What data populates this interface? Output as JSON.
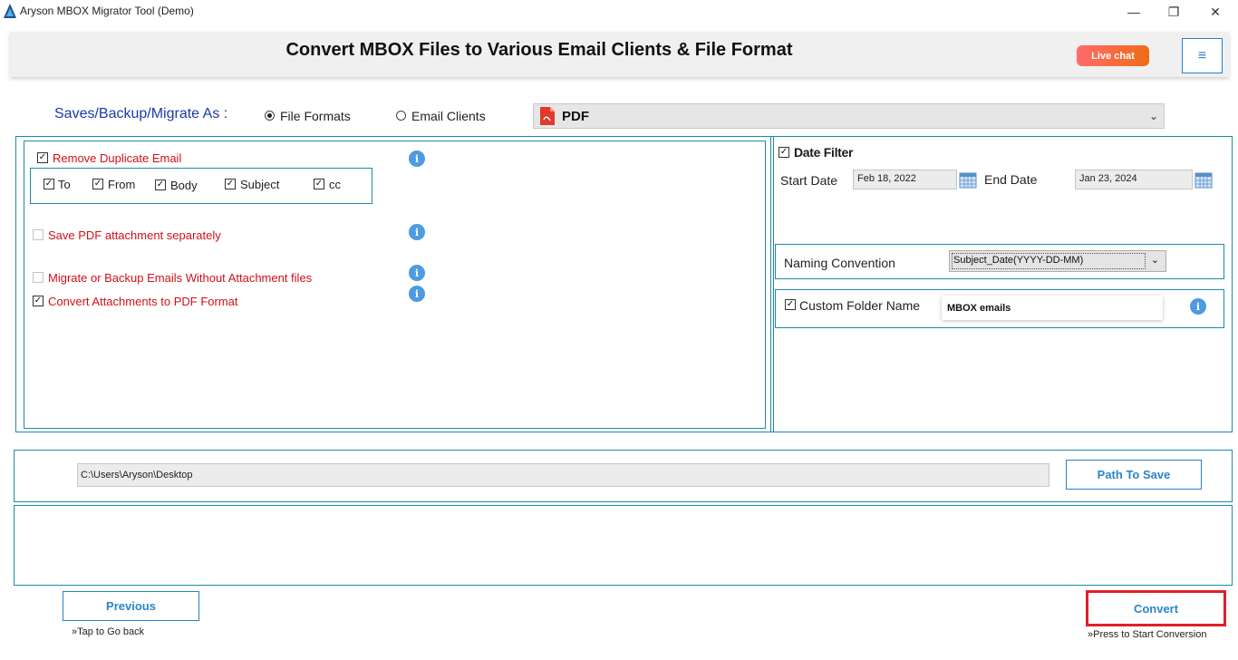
{
  "window": {
    "title": "Aryson MBOX Migrator Tool (Demo)",
    "minimize": "—",
    "maximize": "❐",
    "close": "✕"
  },
  "header": {
    "title": "Convert MBOX Files to Various Email Clients & File Format",
    "live_chat": "Live chat",
    "menu_icon": "≡"
  },
  "save_as": {
    "label": "Saves/Backup/Migrate As :",
    "options": [
      "File Formats",
      "Email Clients"
    ],
    "selected_option": "File Formats",
    "format_value": "PDF",
    "format_icon": "pdf-icon"
  },
  "left_options": {
    "remove_duplicate": {
      "label": "Remove Duplicate Email",
      "checked": true
    },
    "fields": [
      {
        "label": "To",
        "checked": true
      },
      {
        "label": "From",
        "checked": true
      },
      {
        "label": "Body",
        "checked": true
      },
      {
        "label": "Subject",
        "checked": true
      },
      {
        "label": "cc",
        "checked": true
      }
    ],
    "save_pdf_attachment": {
      "label": "Save PDF attachment separately",
      "checked": false
    },
    "without_attachment": {
      "label": "Migrate or Backup Emails Without Attachment files",
      "checked": false
    },
    "convert_attachments": {
      "label": "Convert Attachments to PDF Format",
      "checked": true
    },
    "info_glyph": "i"
  },
  "date_filter": {
    "label": "Date Filter",
    "checked": true,
    "start_label": "Start Date",
    "start_value": "Feb 18, 2022",
    "end_label": "End Date",
    "end_value": "Jan 23, 2024"
  },
  "naming": {
    "label": "Naming Convention",
    "value": "Subject_Date(YYYY-DD-MM)"
  },
  "custom_folder": {
    "label": "Custom Folder Name",
    "checked": true,
    "value": "MBOX emails"
  },
  "path": {
    "value": "C:\\Users\\Aryson\\Desktop",
    "button": "Path To Save"
  },
  "footer": {
    "previous": "Previous",
    "previous_hint": "»Tap to Go back",
    "convert": "Convert",
    "convert_hint": "»Press to Start Conversion"
  },
  "colors": {
    "accent": "#2a7fc8",
    "border": "#1e8aa8",
    "warning_text": "#d0101a",
    "highlight": "#e0202a"
  }
}
